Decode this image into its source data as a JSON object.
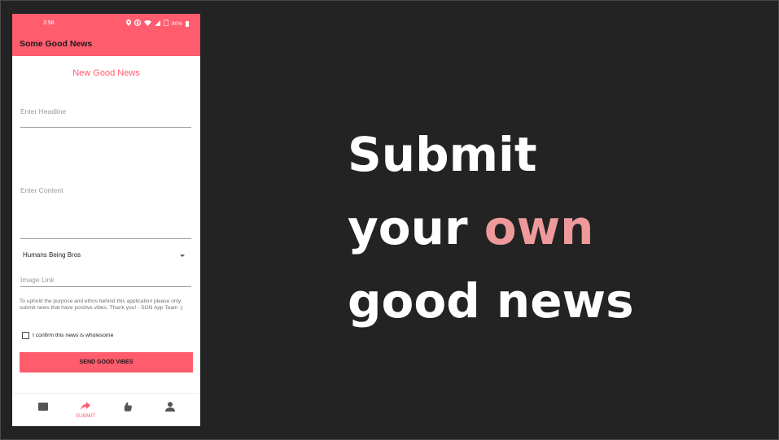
{
  "status_bar": {
    "time": "3:56",
    "battery": "80%"
  },
  "app": {
    "title": "Some Good News"
  },
  "form": {
    "title": "New Good News",
    "headline_placeholder": "Enter Headline",
    "content_placeholder": "Enter Content",
    "category": "Humans Being Bros",
    "image_placeholder": "Image Link",
    "notice": "To uphold the purpose and ethos behind this application please only submit news that have positive vibes. Thank you! - SGN App Team :)",
    "confirm_label": "I confirm this news is wholesome",
    "confirm_checked": false,
    "submit_label": "SEND GOOD VIBES"
  },
  "nav": {
    "items": [
      {
        "icon": "news-icon",
        "label": ""
      },
      {
        "icon": "share-forward-icon",
        "label": "SUBMIT",
        "active": true
      },
      {
        "icon": "thumb-icon",
        "label": ""
      },
      {
        "icon": "person-icon",
        "label": ""
      }
    ]
  },
  "headline": {
    "line1": "Submit",
    "line2_prefix": "your ",
    "line2_accent": "own",
    "line3": "good news"
  },
  "colors": {
    "accent": "#ff5c6e",
    "headline_accent": "#ee9a9c",
    "background": "#232323"
  }
}
